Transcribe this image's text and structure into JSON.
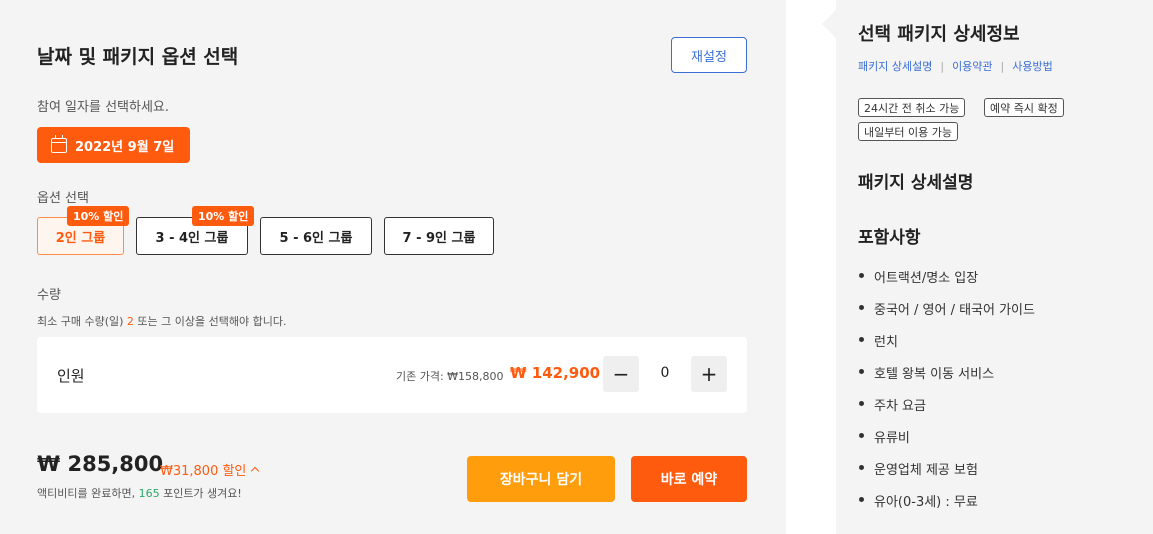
{
  "booking": {
    "title": "날짜 및 패키지 옵션 선택",
    "reset_label": "재설정",
    "date_prompt": "참여 일자를 선택하세요.",
    "selected_date": "2022년 9월 7일",
    "option_label": "옵션 선택",
    "options": [
      {
        "label": "2인 그룹",
        "selected": true,
        "badge": "10% 할인"
      },
      {
        "label": "3 - 4인 그룹",
        "selected": false,
        "badge": "10% 할인"
      },
      {
        "label": "5 - 6인 그룹",
        "selected": false,
        "badge": ""
      },
      {
        "label": "7 - 9인 그룹",
        "selected": false,
        "badge": ""
      }
    ],
    "quantity_label": "수량",
    "min_note_prefix": "최소 구매 수량(일) ",
    "min_qty": "2",
    "min_note_suffix": " 또는 그 이상을 선택해야 합니다.",
    "row": {
      "label": "인원",
      "original_price": "기존 가격: ₩158,800",
      "sale_price": "₩ 142,900",
      "quantity": "0",
      "minus": "−",
      "plus": "+"
    },
    "total_price": "₩ 285,800",
    "total_discount": "₩31,800 할인",
    "points_prefix": "액티비티를 완료하면, ",
    "points_value": "165",
    "points_suffix": " 포인트가 생겨요!",
    "cart_label": "장바구니 담기",
    "book_label": "바로 예약"
  },
  "detail": {
    "title": "선택 패키지 상세정보",
    "links": [
      "패키지 상세설명",
      "이용약관",
      "사용방법"
    ],
    "link_separator": "|",
    "tags": [
      "24시간 전 취소 가능",
      "예약 즉시 확정",
      "내일부터 이용 가능"
    ],
    "package_heading": "패키지 상세설명",
    "includes_heading": "포함사항",
    "includes": [
      "어트랙션/명소 입장",
      "중국어 / 영어 / 태국어 가이드",
      "런치",
      "호텔 왕복 이동 서비스",
      "주차 요금",
      "유류비",
      "운영업체 제공 보험",
      "유아(0-3세) : 무료"
    ]
  },
  "colors": {
    "primary": "#ff5b0f",
    "secondary": "#ff9d0d",
    "link": "#3b6fd6",
    "points": "#2aa86a"
  },
  "icons": {
    "date": "calendar-icon",
    "discount_toggle": "chevron-up-icon"
  }
}
